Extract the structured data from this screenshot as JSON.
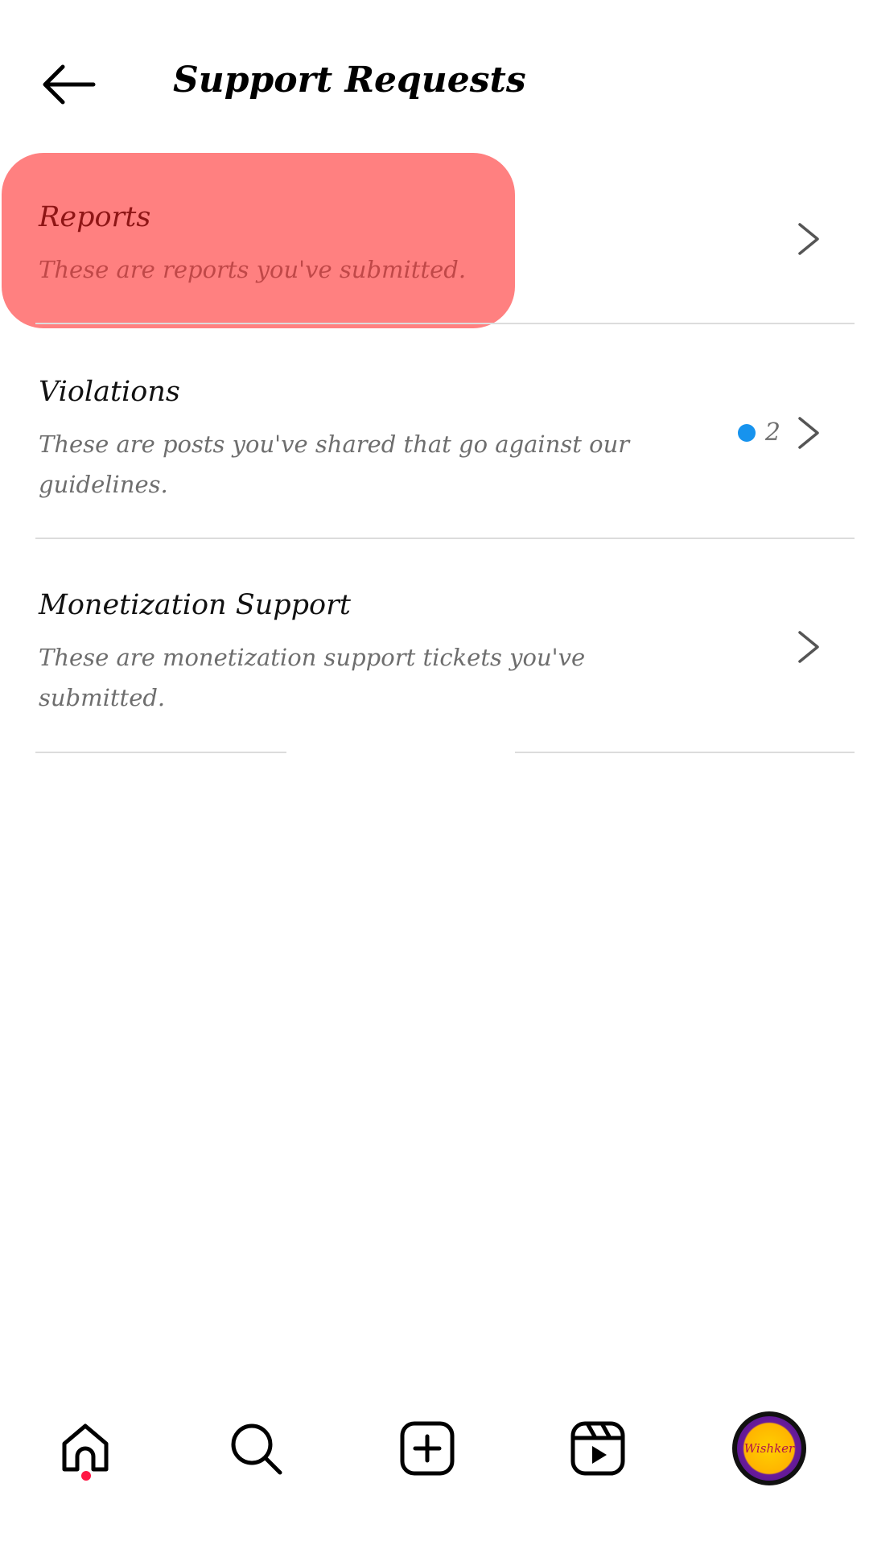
{
  "header": {
    "title": "Support Requests",
    "back_icon": "arrow-left-icon"
  },
  "rows": [
    {
      "title": "Reports",
      "description": "These are reports you've submitted.",
      "highlighted": true
    },
    {
      "title": "Violations",
      "description": "These are posts you've shared that go against our guidelines.",
      "badge_count": "2",
      "badge_color": "#1793ee"
    },
    {
      "title": "Monetization Support",
      "description": "These are monetization support tickets you've submitted."
    }
  ],
  "bottom_nav": {
    "items": [
      "home-icon",
      "search-icon",
      "create-icon",
      "reels-icon",
      "profile-avatar"
    ],
    "active": "home-icon",
    "avatar_text": "Wishker",
    "notification_dot_color": "#ff1744"
  },
  "colors": {
    "highlight": "#ff8080",
    "divider": "#dcdcdc",
    "secondary_text": "#6e6e6e"
  }
}
